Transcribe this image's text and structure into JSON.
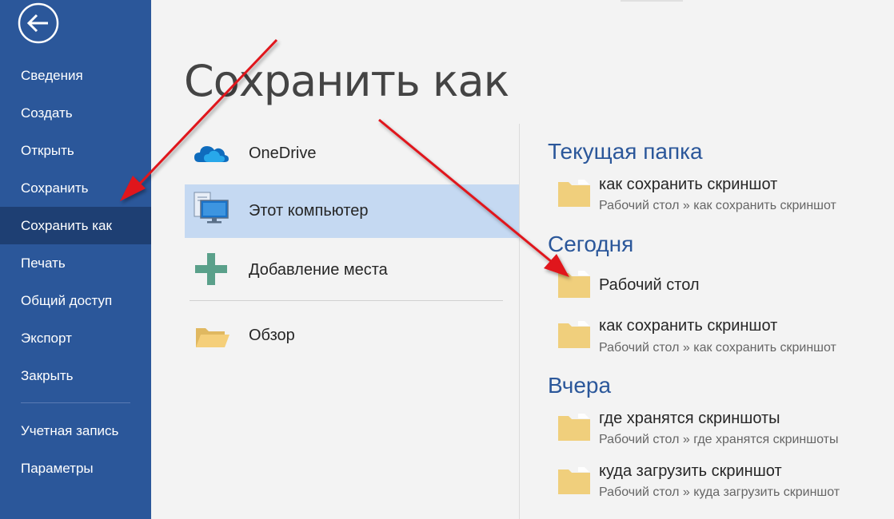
{
  "title": "Сохранить как",
  "sidebar": {
    "items": [
      {
        "label": "Сведения"
      },
      {
        "label": "Создать"
      },
      {
        "label": "Открыть"
      },
      {
        "label": "Сохранить"
      },
      {
        "label": "Сохранить как",
        "active": true
      },
      {
        "label": "Печать"
      },
      {
        "label": "Общий доступ"
      },
      {
        "label": "Экспорт"
      },
      {
        "label": "Закрыть"
      }
    ],
    "bottom_items": [
      {
        "label": "Учетная запись"
      },
      {
        "label": "Параметры"
      }
    ],
    "back_icon": "arrow-left-circle-icon"
  },
  "locations": [
    {
      "label": "OneDrive",
      "icon": "cloud-icon"
    },
    {
      "label": "Этот компьютер",
      "icon": "computer-icon",
      "selected": true
    },
    {
      "label": "Добавление места",
      "icon": "plus-icon"
    },
    {
      "label": "Обзор",
      "icon": "folder-open-icon"
    }
  ],
  "sections": [
    {
      "heading": "Текущая папка",
      "folders": [
        {
          "name": "как сохранить скриншот",
          "path": "Рабочий стол » как сохранить скриншот"
        }
      ]
    },
    {
      "heading": "Сегодня",
      "folders": [
        {
          "name": "Рабочий стол",
          "path": ""
        },
        {
          "name": "как сохранить скриншот",
          "path": "Рабочий стол » как сохранить скриншот"
        }
      ]
    },
    {
      "heading": "Вчера",
      "folders": [
        {
          "name": "где хранятся скриншоты",
          "path": "Рабочий стол » где хранятся скриншоты"
        },
        {
          "name": "куда загрузить скриншот",
          "path": "Рабочий стол » куда загрузить скриншот"
        }
      ]
    }
  ],
  "colors": {
    "sidebar": "#2b579a",
    "sidebar_active": "#1e3f73",
    "selected_location": "#c5d9f2",
    "section_heading": "#2b579a",
    "annotation_arrow": "#e0141b"
  }
}
